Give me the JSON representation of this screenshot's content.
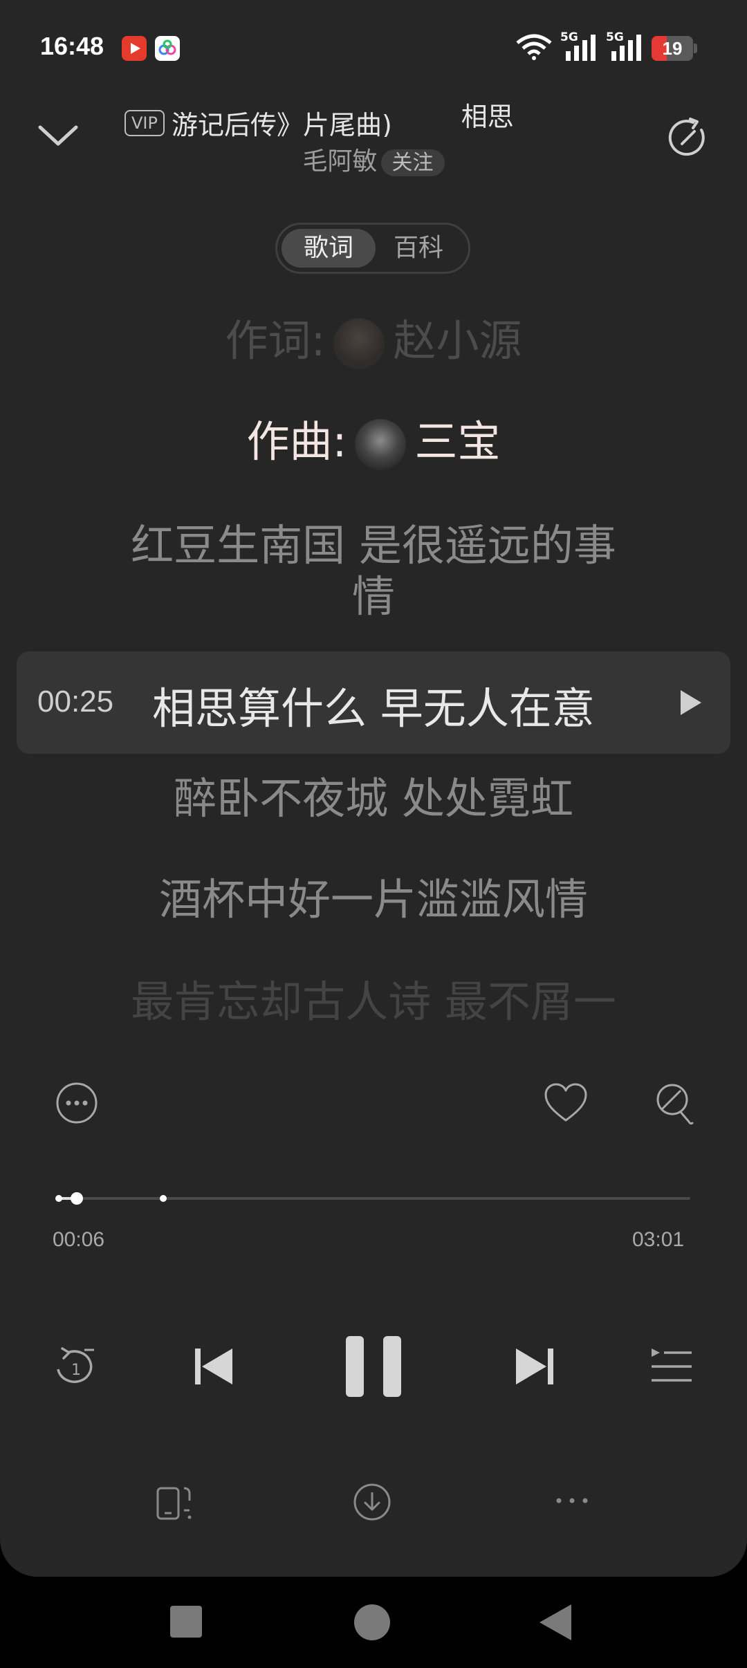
{
  "status": {
    "time": "16:48",
    "network1": "5G",
    "network2": "5G",
    "battery": "19"
  },
  "header": {
    "vip_badge": "VIP",
    "title_scroll": "游记后传》片尾曲)",
    "title_next": "相思",
    "artist": "毛阿敏",
    "follow_label": "关注"
  },
  "tabs": [
    {
      "label": "歌词",
      "active": true
    },
    {
      "label": "百科",
      "active": false
    }
  ],
  "lyrics": {
    "lyricist_prefix": "作词:",
    "lyricist_name": "赵小源",
    "composer_prefix": "作曲:",
    "composer_name": "三宝",
    "line1a": "红豆生南国 是很遥远的事",
    "line1b": "情",
    "current_time": "00:25",
    "current_line": "相思算什么 早无人在意",
    "line3": "醉卧不夜城 处处霓虹",
    "line4": "酒杯中好一片滥滥风情",
    "line5": "最肯忘却古人诗 最不屑一"
  },
  "player": {
    "elapsed": "00:06",
    "duration": "03:01",
    "progress_fraction": 0.033,
    "repeat_badge": "1",
    "colors": {
      "background": "#262626",
      "accent": "#ffffff",
      "app_red": "#e53b2c"
    }
  }
}
